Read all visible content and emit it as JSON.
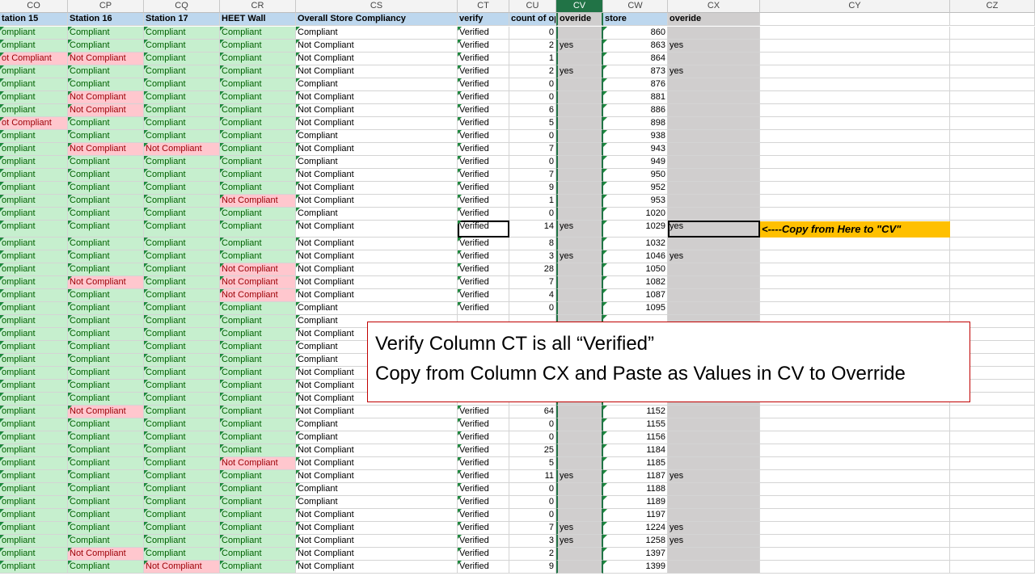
{
  "column_headers": [
    "CO",
    "CP",
    "CQ",
    "CR",
    "CS",
    "CT",
    "CU",
    "CV",
    "CW",
    "CX",
    "CY",
    "CZ"
  ],
  "selected_column": "CV",
  "header_row": [
    "tation 15",
    "Station 16",
    "Station 17",
    "HEET Wall",
    "Overall Store Compliancy",
    "verify",
    "count of op",
    "overide",
    "store",
    "overide"
  ],
  "rows": [
    [
      "ompliant",
      "Compliant",
      "Compliant",
      "Compliant",
      "Compliant",
      "Verified",
      "0",
      "",
      "860",
      ""
    ],
    [
      "ompliant",
      "Compliant",
      "Compliant",
      "Compliant",
      "Not Compliant",
      "Verified",
      "2",
      "yes",
      "863",
      "yes"
    ],
    [
      "ot Compliant",
      "Not Compliant",
      "Compliant",
      "Compliant",
      "Not Compliant",
      "Verified",
      "1",
      "",
      "864",
      ""
    ],
    [
      "ompliant",
      "Compliant",
      "Compliant",
      "Compliant",
      "Not Compliant",
      "Verified",
      "2",
      "yes",
      "873",
      "yes"
    ],
    [
      "ompliant",
      "Compliant",
      "Compliant",
      "Compliant",
      "Compliant",
      "Verified",
      "0",
      "",
      "876",
      ""
    ],
    [
      "ompliant",
      "Not Compliant",
      "Compliant",
      "Compliant",
      "Not Compliant",
      "Verified",
      "0",
      "",
      "881",
      ""
    ],
    [
      "ompliant",
      "Not Compliant",
      "Compliant",
      "Compliant",
      "Not Compliant",
      "Verified",
      "6",
      "",
      "886",
      ""
    ],
    [
      "ot Compliant",
      "Compliant",
      "Compliant",
      "Compliant",
      "Not Compliant",
      "Verified",
      "5",
      "",
      "898",
      ""
    ],
    [
      "ompliant",
      "Compliant",
      "Compliant",
      "Compliant",
      "Compliant",
      "Verified",
      "0",
      "",
      "938",
      ""
    ],
    [
      "ompliant",
      "Not Compliant",
      "Not Compliant",
      "Compliant",
      "Not Compliant",
      "Verified",
      "7",
      "",
      "943",
      ""
    ],
    [
      "ompliant",
      "Compliant",
      "Compliant",
      "Compliant",
      "Compliant",
      "Verified",
      "0",
      "",
      "949",
      ""
    ],
    [
      "ompliant",
      "Compliant",
      "Compliant",
      "Compliant",
      "Not Compliant",
      "Verified",
      "7",
      "",
      "950",
      ""
    ],
    [
      "ompliant",
      "Compliant",
      "Compliant",
      "Compliant",
      "Not Compliant",
      "Verified",
      "9",
      "",
      "952",
      ""
    ],
    [
      "ompliant",
      "Compliant",
      "Compliant",
      "Not Compliant",
      "Not Compliant",
      "Verified",
      "1",
      "",
      "953",
      ""
    ],
    [
      "ompliant",
      "Compliant",
      "Compliant",
      "Compliant",
      "Compliant",
      "Verified",
      "0",
      "",
      "1020",
      ""
    ],
    [
      "ompliant",
      "Compliant",
      "Compliant",
      "Compliant",
      "Not Compliant",
      "Verified",
      "14",
      "yes",
      "1029",
      "yes"
    ],
    [
      "ompliant",
      "Compliant",
      "Compliant",
      "Compliant",
      "Not Compliant",
      "Verified",
      "8",
      "",
      "1032",
      ""
    ],
    [
      "ompliant",
      "Compliant",
      "Compliant",
      "Compliant",
      "Not Compliant",
      "Verified",
      "3",
      "yes",
      "1046",
      "yes"
    ],
    [
      "ompliant",
      "Compliant",
      "Compliant",
      "Not Compliant",
      "Not Compliant",
      "Verified",
      "28",
      "",
      "1050",
      ""
    ],
    [
      "ompliant",
      "Not Compliant",
      "Compliant",
      "Not Compliant",
      "Not Compliant",
      "Verified",
      "7",
      "",
      "1082",
      ""
    ],
    [
      "ompliant",
      "Compliant",
      "Compliant",
      "Not Compliant",
      "Not Compliant",
      "Verified",
      "4",
      "",
      "1087",
      ""
    ],
    [
      "ompliant",
      "Compliant",
      "Compliant",
      "Compliant",
      "Compliant",
      "Verified",
      "0",
      "",
      "1095",
      ""
    ],
    [
      "ompliant",
      "Compliant",
      "Compliant",
      "Compliant",
      "Compliant",
      "",
      "",
      "",
      "",
      ""
    ],
    [
      "ompliant",
      "Compliant",
      "Compliant",
      "Compliant",
      "Not Compliant",
      "",
      "",
      "",
      "",
      ""
    ],
    [
      "ompliant",
      "Compliant",
      "Compliant",
      "Compliant",
      "Compliant",
      "",
      "",
      "",
      "",
      ""
    ],
    [
      "ompliant",
      "Compliant",
      "Compliant",
      "Compliant",
      "Compliant",
      "",
      "",
      "",
      "",
      ""
    ],
    [
      "ompliant",
      "Compliant",
      "Compliant",
      "Compliant",
      "Not Compliant",
      "",
      "",
      "",
      "",
      ""
    ],
    [
      "ompliant",
      "Compliant",
      "Compliant",
      "Compliant",
      "Not Compliant",
      "",
      "",
      "",
      "",
      ""
    ],
    [
      "ompliant",
      "Compliant",
      "Compliant",
      "Compliant",
      "Not Compliant",
      "",
      "",
      "",
      "",
      ""
    ],
    [
      "ompliant",
      "Not Compliant",
      "Compliant",
      "Compliant",
      "Not Compliant",
      "Verified",
      "64",
      "",
      "1152",
      ""
    ],
    [
      "ompliant",
      "Compliant",
      "Compliant",
      "Compliant",
      "Compliant",
      "Verified",
      "0",
      "",
      "1155",
      ""
    ],
    [
      "ompliant",
      "Compliant",
      "Compliant",
      "Compliant",
      "Compliant",
      "Verified",
      "0",
      "",
      "1156",
      ""
    ],
    [
      "ompliant",
      "Compliant",
      "Compliant",
      "Compliant",
      "Not Compliant",
      "Verified",
      "25",
      "",
      "1184",
      ""
    ],
    [
      "ompliant",
      "Compliant",
      "Compliant",
      "Not Compliant",
      "Not Compliant",
      "Verified",
      "5",
      "",
      "1185",
      ""
    ],
    [
      "ompliant",
      "Compliant",
      "Compliant",
      "Compliant",
      "Not Compliant",
      "Verified",
      "11",
      "yes",
      "1187",
      "yes"
    ],
    [
      "ompliant",
      "Compliant",
      "Compliant",
      "Compliant",
      "Compliant",
      "Verified",
      "0",
      "",
      "1188",
      ""
    ],
    [
      "ompliant",
      "Compliant",
      "Compliant",
      "Compliant",
      "Compliant",
      "Verified",
      "0",
      "",
      "1189",
      ""
    ],
    [
      "ompliant",
      "Compliant",
      "Compliant",
      "Compliant",
      "Not Compliant",
      "Verified",
      "0",
      "",
      "1197",
      ""
    ],
    [
      "ompliant",
      "Compliant",
      "Compliant",
      "Compliant",
      "Not Compliant",
      "Verified",
      "7",
      "yes",
      "1224",
      "yes"
    ],
    [
      "ompliant",
      "Compliant",
      "Compliant",
      "Compliant",
      "Not Compliant",
      "Verified",
      "3",
      "yes",
      "1258",
      "yes"
    ],
    [
      "ompliant",
      "Not Compliant",
      "Compliant",
      "Compliant",
      "Not Compliant",
      "Verified",
      "2",
      "",
      "1397",
      ""
    ],
    [
      "ompliant",
      "Compliant",
      "Not Compliant",
      "Compliant",
      "Not Compliant",
      "Verified",
      "9",
      "",
      "1399",
      ""
    ]
  ],
  "callout_text": "<----Copy from Here to \"CV\"",
  "note_line1": "Verify Column CT is all “Verified”",
  "note_line2": "Copy from Column CX and Paste as Values in CV to Override",
  "colors": {
    "compliant_fill": "#c6efce",
    "not_compliant_fill": "#ffc7ce",
    "override_gray": "#d0cece",
    "callout": "#ffc000",
    "header_blue": "#bdd7ee",
    "excel_green": "#217346"
  }
}
